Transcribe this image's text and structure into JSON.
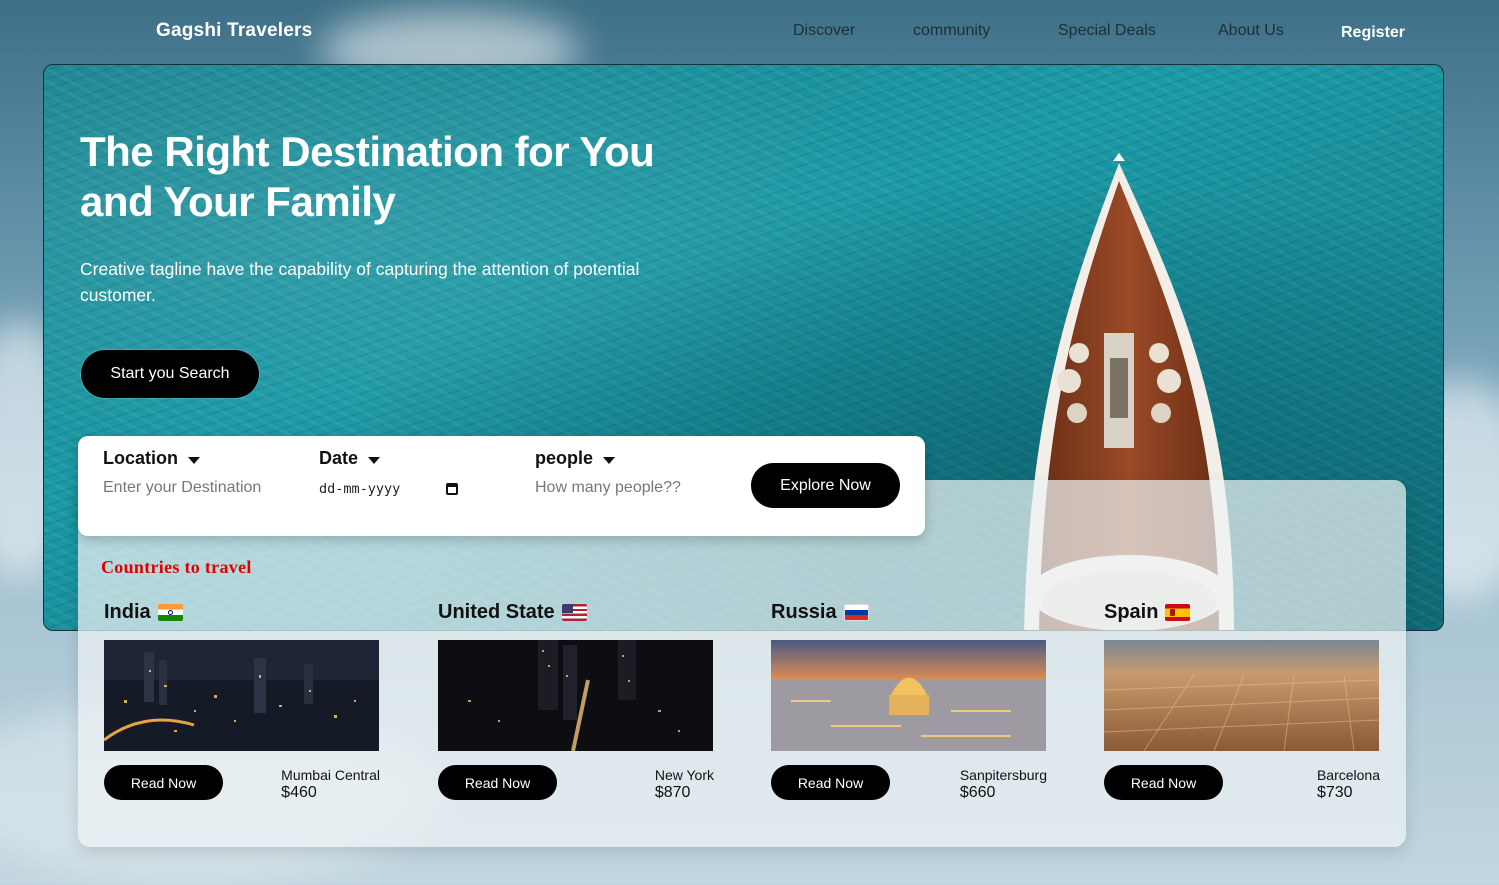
{
  "brand": "Gagshi Travelers",
  "nav": {
    "discover": "Discover",
    "community": "community",
    "deals": "Special Deals",
    "about": "About Us",
    "register": "Register"
  },
  "hero": {
    "title_line1": "The Right Destination for You",
    "title_line2": "and Your Family",
    "tagline": "Creative tagline have the capability of capturing the attention of potential customer.",
    "cta": "Start you Search"
  },
  "search": {
    "location_label": "Location",
    "location_placeholder": "Enter your Destination",
    "date_label": "Date",
    "date_value": "dd-mm-yyyy",
    "people_label": "people",
    "people_placeholder": "How many people??",
    "explore": "Explore Now"
  },
  "countries": {
    "title": "Countries to travel",
    "items": [
      {
        "name": "India",
        "flag": "india-flag-icon",
        "city": "Mumbai Central",
        "price": "$460",
        "button": "Read Now"
      },
      {
        "name": "United State",
        "flag": "usa-flag-icon",
        "city": "New York",
        "price": "$870",
        "button": "Read Now"
      },
      {
        "name": "Russia",
        "flag": "russia-flag-icon",
        "city": "Sanpitersburg",
        "price": "$660",
        "button": "Read Now"
      },
      {
        "name": "Spain",
        "flag": "spain-flag-icon",
        "city": "Barcelona",
        "price": "$730",
        "button": "Read Now"
      }
    ]
  },
  "colors": {
    "accent_red": "#e00000",
    "button_black": "#000000",
    "sea": "#1b9aa6"
  }
}
